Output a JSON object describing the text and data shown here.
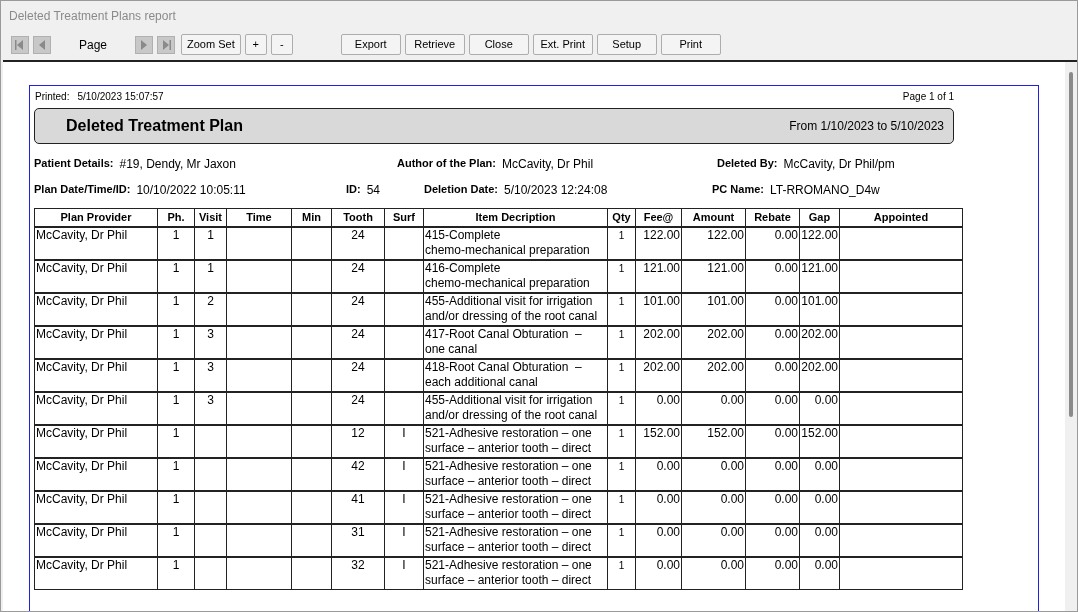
{
  "window": {
    "title": "Deleted Treatment Plans report"
  },
  "toolbar": {
    "nav_buttons": [
      {
        "kind": "first"
      },
      {
        "kind": "prev"
      }
    ],
    "page_label": "Page",
    "nav_buttons_after": [
      {
        "kind": "next"
      },
      {
        "kind": "last"
      }
    ],
    "zoom_buttons": [
      "Zoom Set",
      "+",
      "-"
    ],
    "buttons": [
      "Export",
      "Retrieve",
      "Close",
      "Ext. Print",
      "Setup",
      "Print"
    ]
  },
  "report": {
    "printed_label": "Printed:",
    "printed_value": "5/10/2023 15:07:57",
    "page_info": "Page 1 of 1",
    "title": "Deleted Treatment Plan",
    "date_range": "From 1/10/2023 to 5/10/2023",
    "details": [
      [
        {
          "label": "Patient Details:",
          "value": "#19, Dendy, Mr Jaxon"
        },
        {
          "label": "Author of the Plan:",
          "value": "McCavity, Dr Phil"
        },
        {
          "label": "Deleted By:",
          "value": "McCavity, Dr Phil/pm"
        }
      ],
      [
        {
          "label": "Plan Date/Time/ID:",
          "value": "10/10/2022 10:05:11"
        },
        {
          "label": "ID:",
          "value": "54"
        },
        {
          "label": "Deletion Date:",
          "value": "5/10/2023 12:24:08"
        },
        {
          "label": "PC Name:",
          "value": "LT-RROMANO_D4w"
        }
      ]
    ],
    "table": {
      "columns": [
        "Plan Provider",
        "Ph.",
        "Visit",
        "Time",
        "Min",
        "Tooth",
        "Surf",
        "Item Decription",
        "Qty",
        "Fee@",
        "Amount",
        "Rebate",
        "Gap",
        "Appointed"
      ],
      "rows": [
        {
          "provider": "McCavity, Dr Phil",
          "ph": "1",
          "visit": "1",
          "tooth": "24",
          "description": [
            "415-Complete",
            "chemo-mechanical preparation"
          ],
          "qty": "1",
          "fee": "122.00",
          "amount": "122.00",
          "rebate": "0.00",
          "gap": "122.00"
        },
        {
          "provider": "McCavity, Dr Phil",
          "ph": "1",
          "visit": "1",
          "tooth": "24",
          "description": [
            "416-Complete",
            "chemo-mechanical preparation"
          ],
          "qty": "1",
          "fee": "121.00",
          "amount": "121.00",
          "rebate": "0.00",
          "gap": "121.00"
        },
        {
          "provider": "McCavity, Dr Phil",
          "ph": "1",
          "visit": "2",
          "tooth": "24",
          "description": [
            "455-Additional visit for irrigation",
            "and/or dressing of the root canal"
          ],
          "qty": "1",
          "fee": "101.00",
          "amount": "101.00",
          "rebate": "0.00",
          "gap": "101.00"
        },
        {
          "provider": "McCavity, Dr Phil",
          "ph": "1",
          "visit": "3",
          "tooth": "24",
          "description": [
            "417-Root Canal Obturation  –",
            "one canal"
          ],
          "qty": "1",
          "fee": "202.00",
          "amount": "202.00",
          "rebate": "0.00",
          "gap": "202.00"
        },
        {
          "provider": "McCavity, Dr Phil",
          "ph": "1",
          "visit": "3",
          "tooth": "24",
          "description": [
            "418-Root Canal Obturation  –",
            "each additional canal"
          ],
          "qty": "1",
          "fee": "202.00",
          "amount": "202.00",
          "rebate": "0.00",
          "gap": "202.00"
        },
        {
          "provider": "McCavity, Dr Phil",
          "ph": "1",
          "visit": "3",
          "tooth": "24",
          "description": [
            "455-Additional visit for irrigation",
            "and/or dressing of the root canal"
          ],
          "qty": "1",
          "fee": "0.00",
          "amount": "0.00",
          "rebate": "0.00",
          "gap": "0.00"
        },
        {
          "provider": "McCavity, Dr Phil",
          "ph": "1",
          "tooth": "12",
          "surf": "I",
          "description": [
            "521-Adhesive restoration – one",
            "surface – anterior tooth – direct"
          ],
          "qty": "1",
          "fee": "152.00",
          "amount": "152.00",
          "rebate": "0.00",
          "gap": "152.00"
        },
        {
          "provider": "McCavity, Dr Phil",
          "ph": "1",
          "tooth": "42",
          "surf": "I",
          "description": [
            "521-Adhesive restoration – one",
            "surface – anterior tooth – direct"
          ],
          "qty": "1",
          "fee": "0.00",
          "amount": "0.00",
          "rebate": "0.00",
          "gap": "0.00"
        },
        {
          "provider": "McCavity, Dr Phil",
          "ph": "1",
          "tooth": "41",
          "surf": "I",
          "description": [
            "521-Adhesive restoration – one",
            "surface – anterior tooth – direct"
          ],
          "qty": "1",
          "fee": "0.00",
          "amount": "0.00",
          "rebate": "0.00",
          "gap": "0.00"
        },
        {
          "provider": "McCavity, Dr Phil",
          "ph": "1",
          "tooth": "31",
          "surf": "I",
          "description": [
            "521-Adhesive restoration – one",
            "surface – anterior tooth – direct"
          ],
          "qty": "1",
          "fee": "0.00",
          "amount": "0.00",
          "rebate": "0.00",
          "gap": "0.00"
        },
        {
          "provider": "McCavity, Dr Phil",
          "ph": "1",
          "tooth": "32",
          "surf": "I",
          "description": [
            "521-Adhesive restoration – one",
            "surface – anterior tooth – direct"
          ],
          "qty": "1",
          "fee": "0.00",
          "amount": "0.00",
          "rebate": "0.00",
          "gap": "0.00"
        }
      ]
    }
  }
}
